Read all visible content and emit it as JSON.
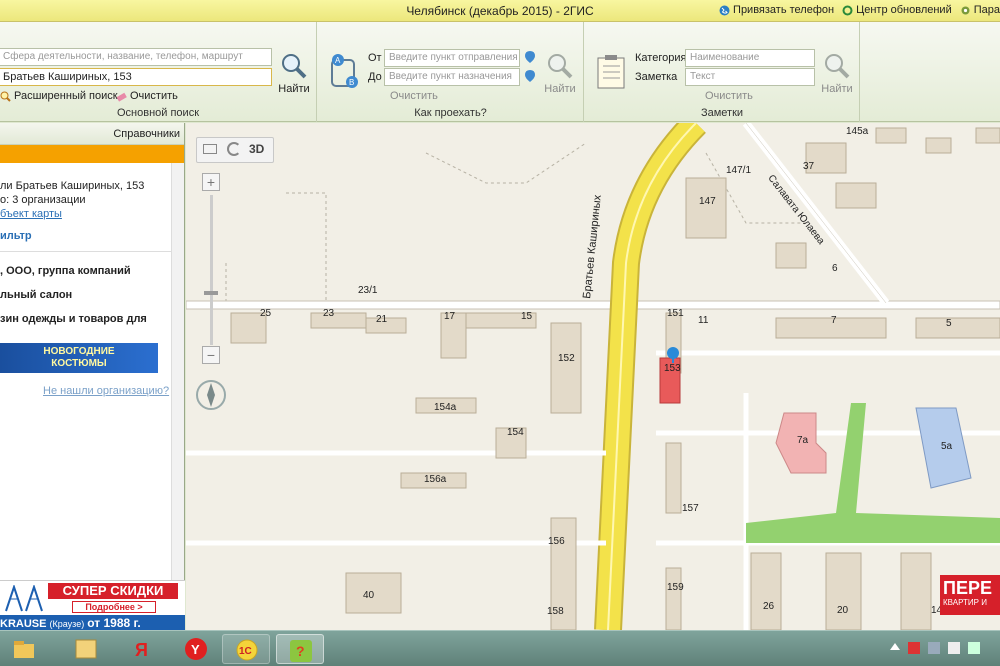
{
  "window": {
    "title": "Челябинск (декабрь 2015) - 2ГИС",
    "link_phone": "Привязать телефон",
    "update_center": "Центр обновлений",
    "params": "Пара"
  },
  "ribbon": {
    "main_search": {
      "title": "Основной поиск",
      "query_placeholder": "Сфера деятельности, название, телефон, маршрут",
      "address_value": "Братьев Кашириных, 153",
      "find": "Найти",
      "advanced": "Расширенный поиск",
      "clear": "Очистить"
    },
    "route": {
      "title": "Как проехать?",
      "from_label": "От",
      "to_label": "До",
      "from_placeholder": "Введите пункт отправления",
      "to_placeholder": "Введите пункт назначения",
      "find": "Найти",
      "clear": "Очистить"
    },
    "notes": {
      "title": "Заметки",
      "category_label": "Категория",
      "note_label": "Заметка",
      "category_placeholder": "Наименование",
      "note_placeholder": "Текст",
      "find": "Найти",
      "clear": "Очистить"
    }
  },
  "left_panel": {
    "directories": "Справочники",
    "address_line": "ли Братьев Кашириных, 153",
    "orgs_line": "о: 3 организации",
    "map_object": "бъект карты",
    "filter": "ильтр",
    "results": [
      ", ООО, группа компаний",
      "льный салон",
      "зин одежды и товаров для"
    ],
    "banner_top": "НОВОГОДНИЕ",
    "banner_bottom": "КОСТЮМЫ",
    "not_found": "Не нашли организацию?",
    "ad_title": "СУПЕР СКИДКИ",
    "ad_more": "Подробнее >",
    "ad_brand": "KRAUSE",
    "ad_brand_sub": "(Краузе)",
    "ad_since": "от 1988 г."
  },
  "map": {
    "view_3d": "3D",
    "street_main": "Братьев Кашириных",
    "street_side": "Салавата Юлаева",
    "ad_text": "ПЕРЕ",
    "ad_sub": "КВАРТИР И",
    "labels": [
      "145а",
      "37",
      "147/1",
      "147",
      "6",
      "23/1",
      "25",
      "23",
      "21",
      "17",
      "15",
      "152",
      "151",
      "11",
      "7",
      "5",
      "153",
      "154а",
      "154",
      "156а",
      "7а",
      "5а",
      "157",
      "156",
      "159",
      "40",
      "158",
      "26",
      "20",
      "14"
    ]
  },
  "colors": {
    "ribbon_bg": "#eef2e4",
    "orange_accent": "#f5a100",
    "road_yellow": "#f3e24a",
    "selected_building": "#e85a5a",
    "title_bar": "#f1ec8a"
  }
}
